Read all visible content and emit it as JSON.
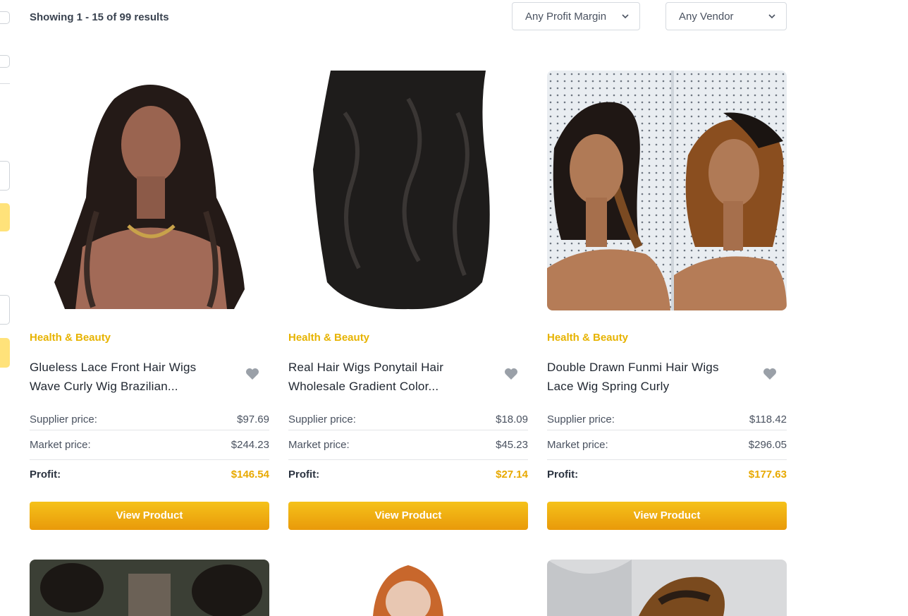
{
  "header": {
    "results_text": "Showing 1 - 15 of 99 results",
    "profit_filter": "Any Profit Margin",
    "vendor_filter": "Any Vendor"
  },
  "products": [
    {
      "category": "Health & Beauty",
      "title_line1": "Glueless Lace Front Hair Wigs",
      "title_line2": "Wave Curly Wig Brazilian...",
      "supplier_label": "Supplier price:",
      "supplier_price": "$97.69",
      "market_label": "Market price:",
      "market_price": "$244.23",
      "profit_label": "Profit:",
      "profit": "$146.54",
      "button": "View Product"
    },
    {
      "category": "Health & Beauty",
      "title_line1": "Real Hair Wigs Ponytail Hair",
      "title_line2": "Wholesale Gradient Color...",
      "supplier_label": "Supplier price:",
      "supplier_price": "$18.09",
      "market_label": "Market price:",
      "market_price": "$45.23",
      "profit_label": "Profit:",
      "profit": "$27.14",
      "button": "View Product"
    },
    {
      "category": "Health & Beauty",
      "title_line1": "Double Drawn Funmi Hair Wigs",
      "title_line2": "Lace Wig Spring Curly",
      "supplier_label": "Supplier price:",
      "supplier_price": "$118.42",
      "market_label": "Market price:",
      "market_price": "$296.05",
      "profit_label": "Profit:",
      "profit": "$177.63",
      "button": "View Product"
    }
  ],
  "colors": {
    "accent": "#e7b300",
    "button_top": "#f5c21a",
    "button_bottom": "#e99a0a",
    "heart": "#9aa0a8"
  },
  "icons": [
    "chevron-down-icon",
    "heart-icon"
  ]
}
